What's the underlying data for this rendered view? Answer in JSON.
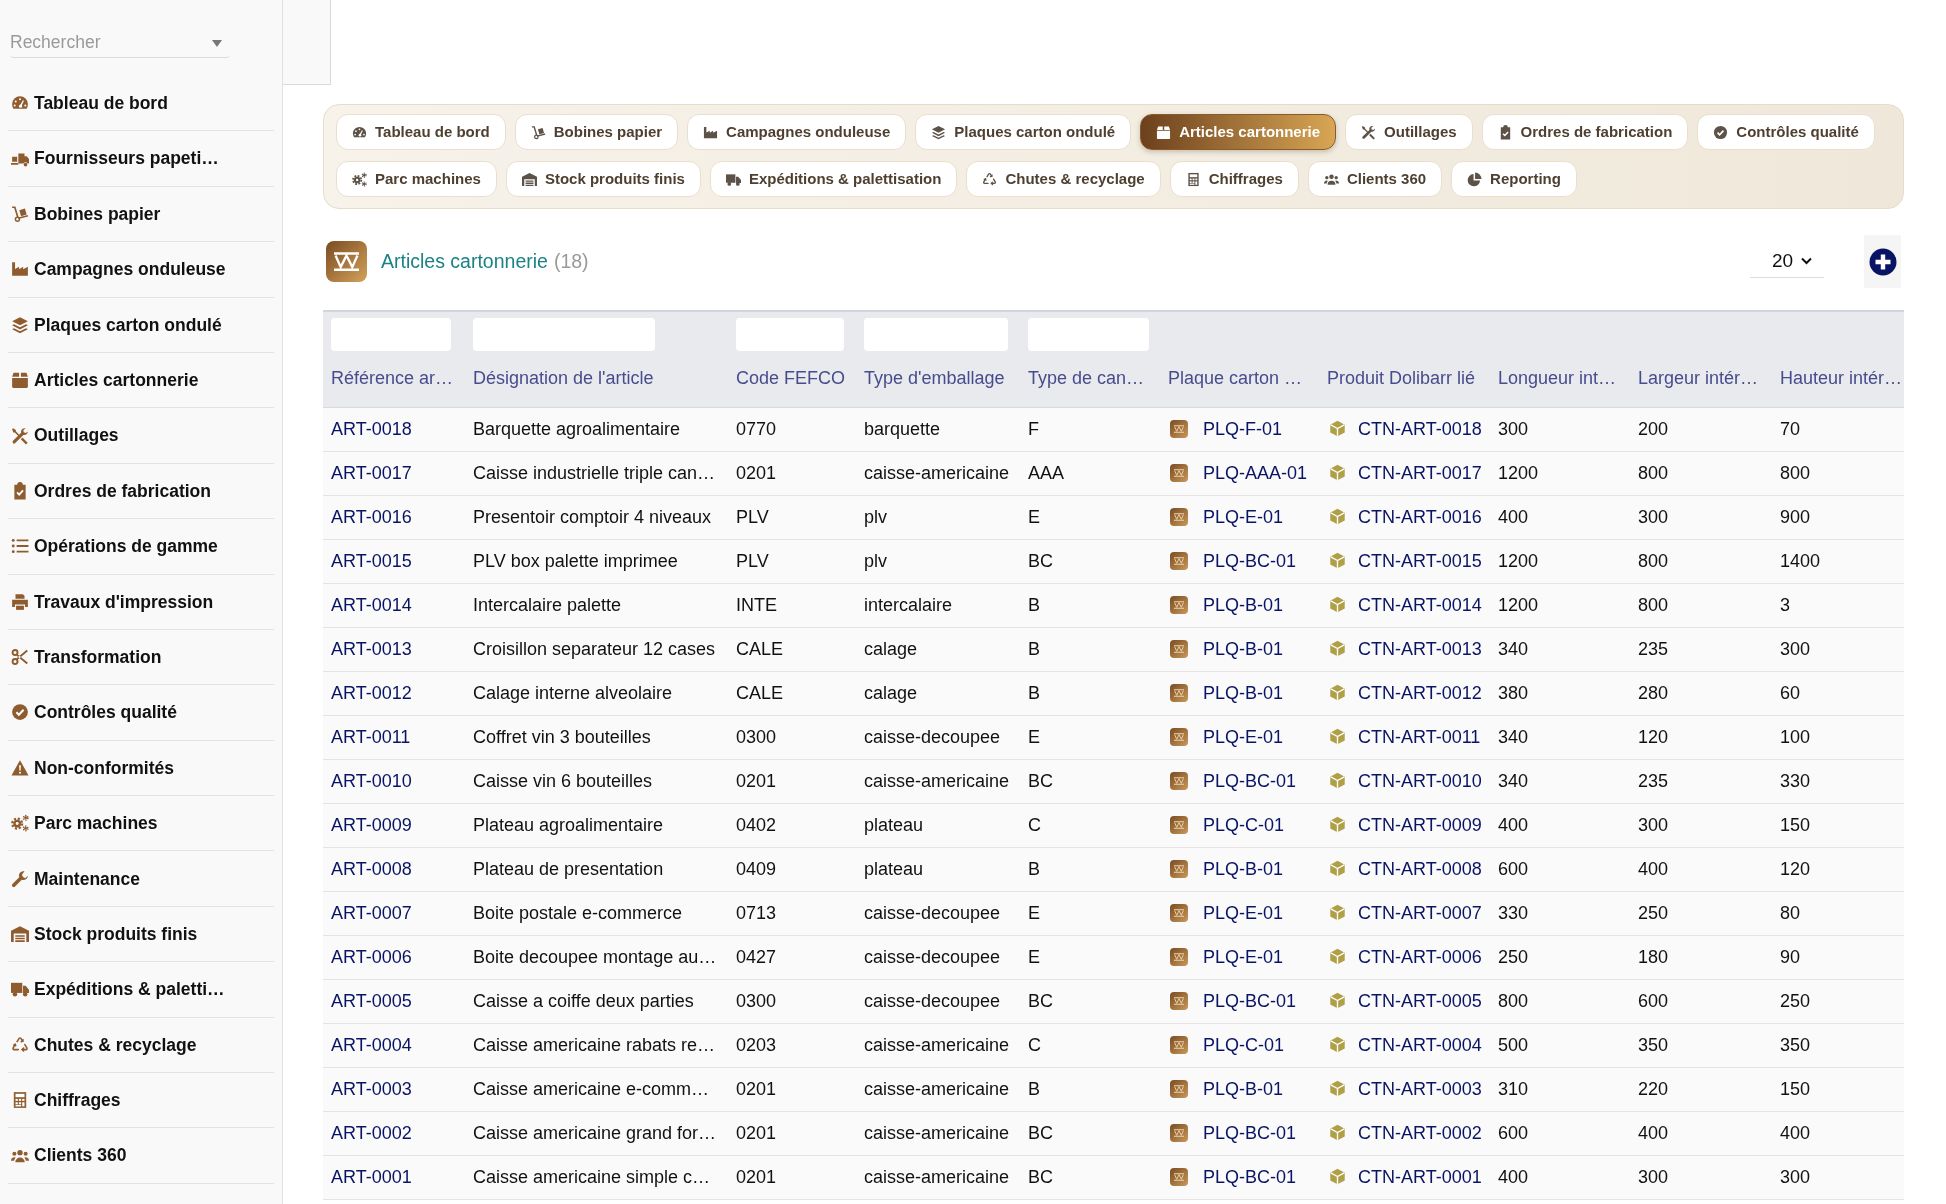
{
  "sidebar": {
    "search": {
      "placeholder": "Rechercher"
    },
    "items": [
      "Tableau de bord",
      "Fournisseurs papeti…",
      "Bobines papier",
      "Campagnes onduleuse",
      "Plaques carton ondulé",
      "Articles cartonnerie",
      "Outillages",
      "Ordres de fabrication",
      "Opérations de gamme",
      "Travaux d'impression",
      "Transformation",
      "Contrôles qualité",
      "Non-conformités",
      "Parc machines",
      "Maintenance",
      "Stock produits finis",
      "Expéditions & paletti…",
      "Chutes & recyclage",
      "Chiffrages",
      "Clients 360"
    ]
  },
  "tabs": [
    {
      "label": "Tableau de bord",
      "selected": false
    },
    {
      "label": "Bobines papier",
      "selected": false
    },
    {
      "label": "Campagnes onduleuse",
      "selected": false
    },
    {
      "label": "Plaques carton ondulé",
      "selected": false
    },
    {
      "label": "Articles cartonnerie",
      "selected": true
    },
    {
      "label": "Outillages",
      "selected": false
    },
    {
      "label": "Ordres de fabrication",
      "selected": false
    },
    {
      "label": "Contrôles qualité",
      "selected": false
    },
    {
      "label": "Parc machines",
      "selected": false
    },
    {
      "label": "Stock produits finis",
      "selected": false
    },
    {
      "label": "Expéditions & palettisation",
      "selected": false
    },
    {
      "label": "Chutes & recyclage",
      "selected": false
    },
    {
      "label": "Chiffrages",
      "selected": false
    },
    {
      "label": "Clients 360",
      "selected": false
    },
    {
      "label": "Reporting",
      "selected": false
    }
  ],
  "page": {
    "title": "Articles cartonnerie",
    "count": "(18)",
    "page_size": "20"
  },
  "table": {
    "columns": [
      {
        "label": "Référence ar…",
        "kind": "link",
        "filter": true
      },
      {
        "label": "Désignation de l'article",
        "kind": "text",
        "filter": true
      },
      {
        "label": "Code FEFCO",
        "kind": "text",
        "filter": true
      },
      {
        "label": "Type d'emballage",
        "kind": "text",
        "filter": true
      },
      {
        "label": "Type de can…",
        "kind": "text",
        "filter": true
      },
      {
        "label": "Plaque carton …",
        "kind": "plate",
        "filter": false
      },
      {
        "label": "Produit Dolibarr lié",
        "kind": "product",
        "filter": false
      },
      {
        "label": "Longueur int…",
        "kind": "text",
        "filter": false
      },
      {
        "label": "Largeur intér…",
        "kind": "text",
        "filter": false
      },
      {
        "label": "Hauteur intér…",
        "kind": "text",
        "filter": false
      }
    ],
    "rows": [
      [
        "ART-0018",
        "Barquette agroalimentaire",
        "0770",
        "barquette",
        "F",
        "PLQ-F-01",
        "CTN-ART-0018",
        "300",
        "200",
        "70"
      ],
      [
        "ART-0017",
        "Caisse industrielle triple can…",
        "0201",
        "caisse-americaine",
        "AAA",
        "PLQ-AAA-01",
        "CTN-ART-0017",
        "1200",
        "800",
        "800"
      ],
      [
        "ART-0016",
        "Presentoir comptoir 4 niveaux",
        "PLV",
        "plv",
        "E",
        "PLQ-E-01",
        "CTN-ART-0016",
        "400",
        "300",
        "900"
      ],
      [
        "ART-0015",
        "PLV box palette imprimee",
        "PLV",
        "plv",
        "BC",
        "PLQ-BC-01",
        "CTN-ART-0015",
        "1200",
        "800",
        "1400"
      ],
      [
        "ART-0014",
        "Intercalaire palette",
        "INTE",
        "intercalaire",
        "B",
        "PLQ-B-01",
        "CTN-ART-0014",
        "1200",
        "800",
        "3"
      ],
      [
        "ART-0013",
        "Croisillon separateur 12 cases",
        "CALE",
        "calage",
        "B",
        "PLQ-B-01",
        "CTN-ART-0013",
        "340",
        "235",
        "300"
      ],
      [
        "ART-0012",
        "Calage interne alveolaire",
        "CALE",
        "calage",
        "B",
        "PLQ-B-01",
        "CTN-ART-0012",
        "380",
        "280",
        "60"
      ],
      [
        "ART-0011",
        "Coffret vin 3 bouteilles",
        "0300",
        "caisse-decoupee",
        "E",
        "PLQ-E-01",
        "CTN-ART-0011",
        "340",
        "120",
        "100"
      ],
      [
        "ART-0010",
        "Caisse vin 6 bouteilles",
        "0201",
        "caisse-americaine",
        "BC",
        "PLQ-BC-01",
        "CTN-ART-0010",
        "340",
        "235",
        "330"
      ],
      [
        "ART-0009",
        "Plateau agroalimentaire",
        "0402",
        "plateau",
        "C",
        "PLQ-C-01",
        "CTN-ART-0009",
        "400",
        "300",
        "150"
      ],
      [
        "ART-0008",
        "Plateau de presentation",
        "0409",
        "plateau",
        "B",
        "PLQ-B-01",
        "CTN-ART-0008",
        "600",
        "400",
        "120"
      ],
      [
        "ART-0007",
        "Boite postale e-commerce",
        "0713",
        "caisse-decoupee",
        "E",
        "PLQ-E-01",
        "CTN-ART-0007",
        "330",
        "250",
        "80"
      ],
      [
        "ART-0006",
        "Boite decoupee montage au…",
        "0427",
        "caisse-decoupee",
        "E",
        "PLQ-E-01",
        "CTN-ART-0006",
        "250",
        "180",
        "90"
      ],
      [
        "ART-0005",
        "Caisse a coiffe deux parties",
        "0300",
        "caisse-decoupee",
        "BC",
        "PLQ-BC-01",
        "CTN-ART-0005",
        "800",
        "600",
        "250"
      ],
      [
        "ART-0004",
        "Caisse americaine rabats re…",
        "0203",
        "caisse-americaine",
        "C",
        "PLQ-C-01",
        "CTN-ART-0004",
        "500",
        "350",
        "350"
      ],
      [
        "ART-0003",
        "Caisse americaine e-comm…",
        "0201",
        "caisse-americaine",
        "B",
        "PLQ-B-01",
        "CTN-ART-0003",
        "310",
        "220",
        "150"
      ],
      [
        "ART-0002",
        "Caisse americaine grand for…",
        "0201",
        "caisse-americaine",
        "BC",
        "PLQ-BC-01",
        "CTN-ART-0002",
        "600",
        "400",
        "400"
      ],
      [
        "ART-0001",
        "Caisse americaine simple c…",
        "0201",
        "caisse-americaine",
        "BC",
        "PLQ-BC-01",
        "CTN-ART-0001",
        "400",
        "300",
        "300"
      ]
    ]
  }
}
